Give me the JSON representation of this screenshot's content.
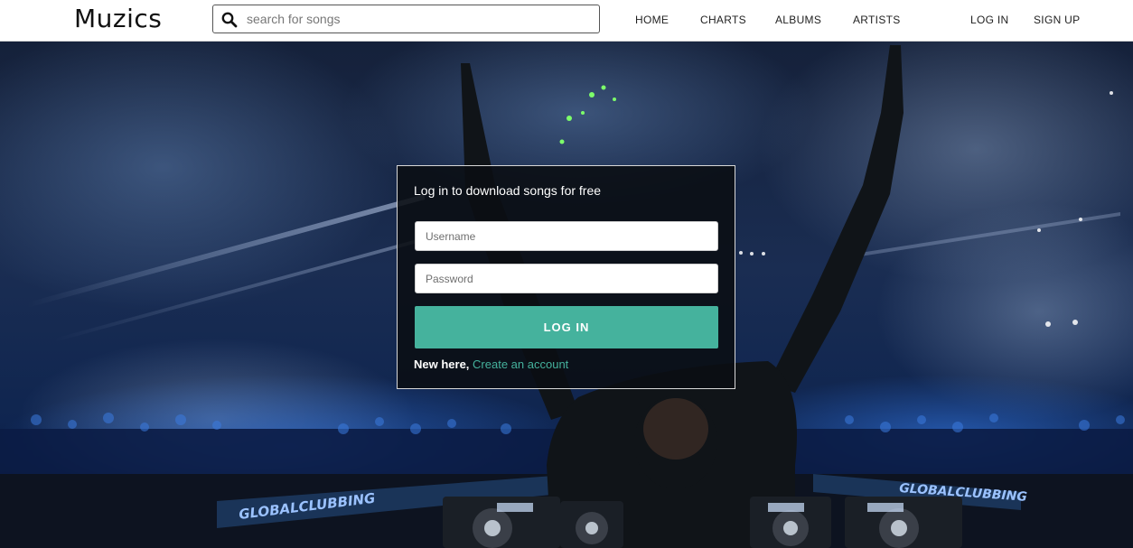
{
  "brand": {
    "name": "Muzics"
  },
  "search": {
    "placeholder": "search for songs",
    "icon": "search-icon"
  },
  "nav": {
    "links": [
      "HOME",
      "CHARTS",
      "ALBUMS",
      "ARTISTS"
    ],
    "auth": [
      "LOG IN",
      "SIGN UP"
    ]
  },
  "login": {
    "title": "Log in to download songs for free",
    "username_placeholder": "Username",
    "password_placeholder": "Password",
    "button_label": "LOG IN",
    "signup_prompt": "New here,",
    "signup_link": "Create an account"
  },
  "hero": {
    "image": "DJ performing on stage with both arms raised, concert crowd and stage lights in background",
    "banner_text": "GLOBALCLUBBING"
  },
  "colors": {
    "accent": "#45b29d",
    "navbar_bg": "#ffffff",
    "card_bg": "#0a0e12"
  }
}
